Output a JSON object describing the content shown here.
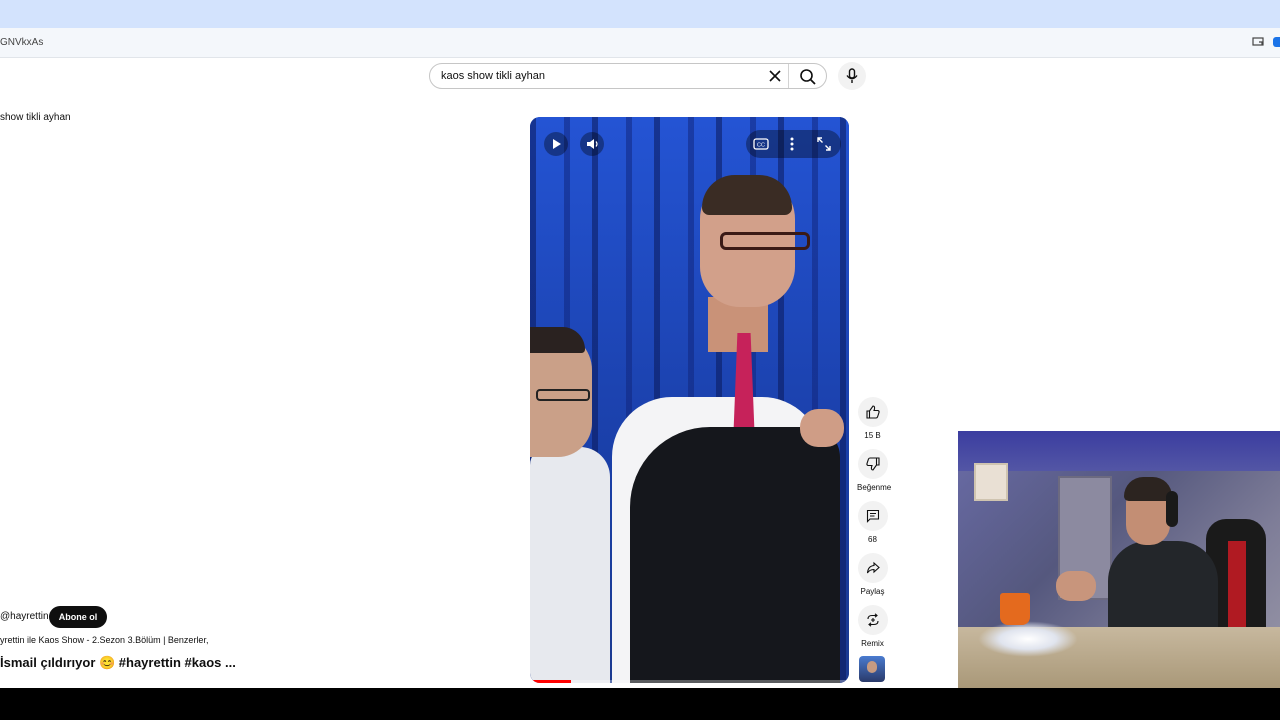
{
  "browser": {
    "url_fragment": "GNVkxAs"
  },
  "search": {
    "query": "kaos show tikli ayhan"
  },
  "sidebar": {
    "query_echo": "show tikli ayhan"
  },
  "actions": {
    "like_count": "15 B",
    "dislike_label": "Beğenme",
    "comment_count": "68",
    "share_label": "Paylaş",
    "remix_label": "Remix"
  },
  "video": {
    "channel": "@hayrettin",
    "subscribe_label": "Abone ol",
    "reference": "yrettin ile Kaos Show - 2.Sezon 3.Bölüm | Benzerler,",
    "title": "İsmail çıldırıyor 😊  #hayrettin #kaos ...",
    "progress": 0.13
  },
  "colors": {
    "subscribe_bg": "#0f0f0f",
    "progress": "#ff0000",
    "browser_chrome": "#d3e3fd"
  }
}
